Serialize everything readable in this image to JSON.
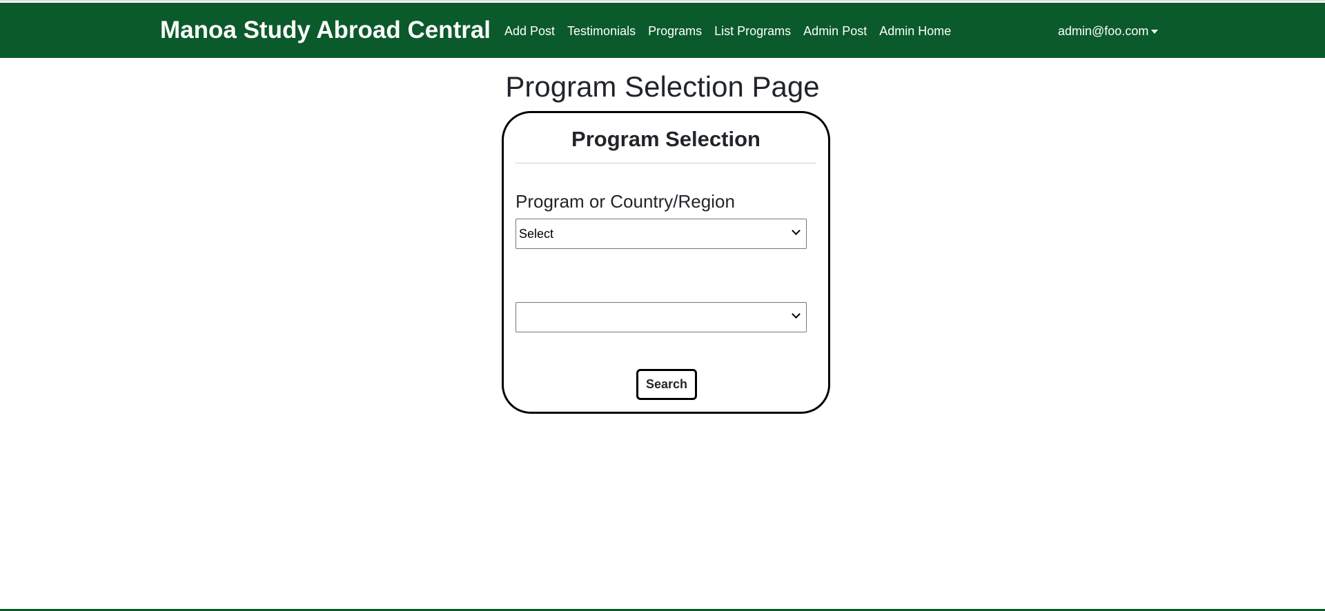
{
  "navbar": {
    "brand": "Manoa Study Abroad Central",
    "links": [
      "Add Post",
      "Testimonials",
      "Programs",
      "List Programs",
      "Admin Post",
      "Admin Home"
    ],
    "user": "admin@foo.com"
  },
  "page": {
    "title": "Program Selection Page"
  },
  "card": {
    "title": "Program Selection",
    "label": "Program or Country/Region",
    "select1_value": "Select",
    "select2_value": "",
    "search_label": "Search"
  },
  "colors": {
    "brand": "#0b5a2b"
  }
}
